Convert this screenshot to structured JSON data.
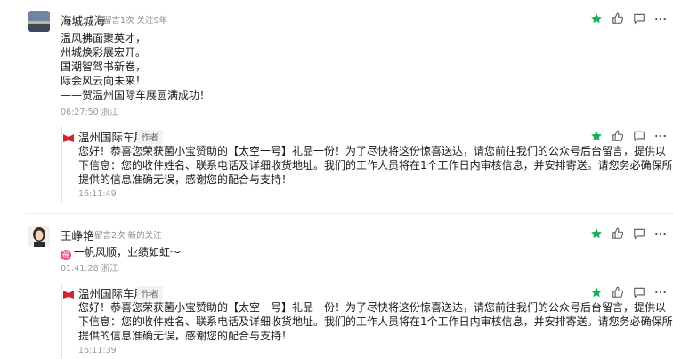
{
  "comments": [
    {
      "name": "海城城海",
      "meta": "留言1次  关注9年",
      "lines": [
        "温风拂面聚英才，",
        " 州城焕彩展宏开。",
        " 国潮智驾书新卷，",
        " 际会风云向未来！",
        "   ——贺温州国际车展圆满成功！"
      ],
      "time": "06:27:50 浙江",
      "reply": {
        "name": "温州国际车展",
        "tag": "作者",
        "lines": [
          "您好！恭喜您荣获菌小宝赞助的【太空一号】礼品一份！为了尽快将这份惊喜送达，请您前往我们的公众号后台留言，提供以",
          "下信息：您的收件姓名、联系电话及详细收货地址。我们的工作人员将在1个工作日内审核信息，并安排寄送。请您务必确保所",
          "提供的信息准确无误，感谢您的配合与支持！"
        ],
        "time": "16:11:49"
      }
    },
    {
      "name": "王峥艳",
      "meta": "留言2次  新的关注",
      "emoji_char": "福",
      "lines": [
        "一帆风顺，业绩如虹～"
      ],
      "time": "01:41:28 浙江",
      "reply": {
        "name": "温州国际车展",
        "tag": "作者",
        "lines": [
          "您好！恭喜您荣获菌小宝赞助的【太空一号】礼品一份！为了尽快将这份惊喜送达，请您前往我们的公众号后台留言，提供以",
          "下信息：您的收件姓名、联系电话及详细收货地址。我们的工作人员将在1个工作日内审核信息，并安排寄送。请您务必确保所",
          "提供的信息准确无误，感谢您的配合与支持！"
        ],
        "time": "16:11:39"
      }
    }
  ],
  "icons": {
    "star": "star-icon",
    "like": "thumbs-up-icon",
    "reply": "reply-bubble-icon",
    "more": "more-dots-icon"
  },
  "colors": {
    "star_green": "#1aad5a",
    "icon_gray": "#555555",
    "brand_red": "#d0262d"
  }
}
